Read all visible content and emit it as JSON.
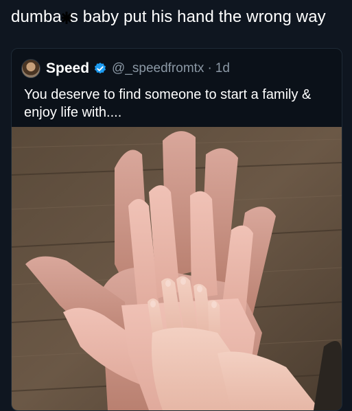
{
  "caption": {
    "before": "dumba",
    "after": "s baby put his hand the wrong way"
  },
  "tweet": {
    "name": "Speed",
    "handle": "@_speedfromtx",
    "separator": "·",
    "time": "1d",
    "text": "You deserve to find someone to start a family & enjoy life with....",
    "verified_color": "#1d9bf0",
    "icons": [
      "avatar",
      "verified-badge-icon"
    ]
  },
  "photo": {
    "description_icon": "hands-photo"
  }
}
